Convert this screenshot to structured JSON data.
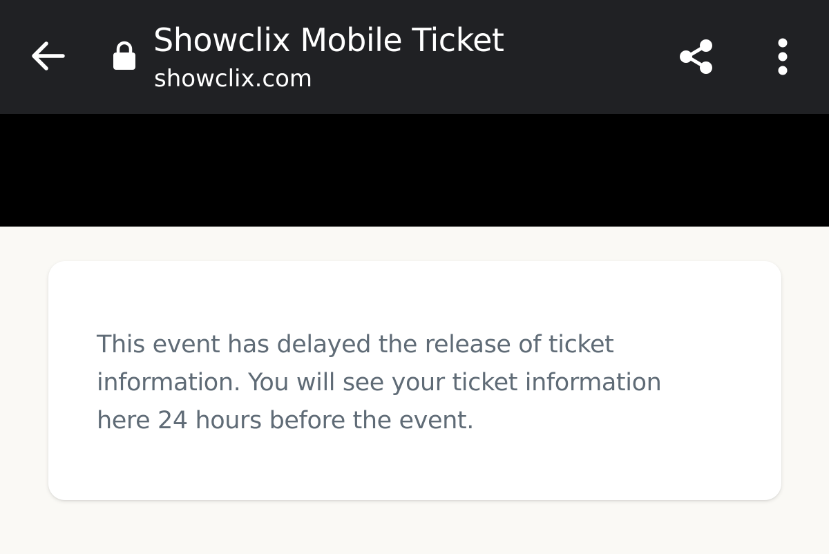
{
  "toolbar": {
    "title": "Showclix Mobile Ticket",
    "url": "showclix.com",
    "icons": {
      "back": "arrow-left-icon",
      "lock": "lock-icon",
      "share": "share-icon",
      "menu": "more-vert-icon"
    }
  },
  "card": {
    "message": "This event has delayed the release of ticket information. You will see your ticket information here 24 hours before the event."
  },
  "colors": {
    "toolbar_bg": "#202124",
    "banner_bg": "#000000",
    "page_bg": "#faf9f5",
    "card_bg": "#ffffff",
    "message_text": "#5f6b76"
  }
}
